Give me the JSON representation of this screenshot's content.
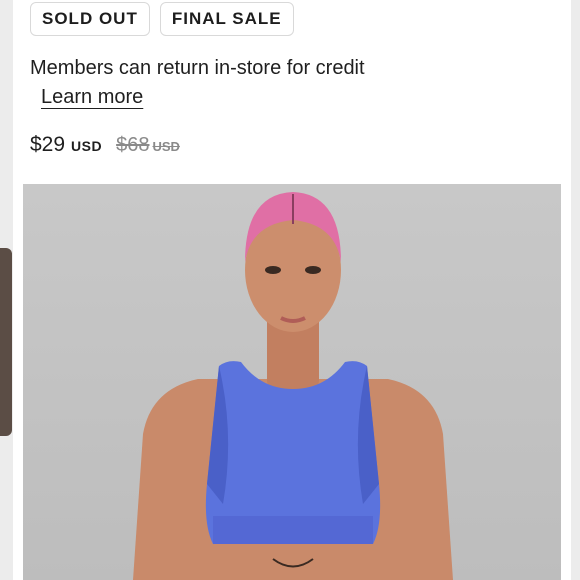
{
  "badges": {
    "sold_out": "SOLD OUT",
    "final_sale": "FINAL SALE"
  },
  "notice": {
    "text": "Members can return in-store for credit",
    "link": "Learn more"
  },
  "price": {
    "current": "$29",
    "currency": "USD",
    "original": "$68",
    "original_currency": "USD"
  },
  "colors": {
    "top": "#5b73dd",
    "hair": "#e06fa5",
    "skin": "#c98a6a",
    "background": "#c4c4c4"
  }
}
